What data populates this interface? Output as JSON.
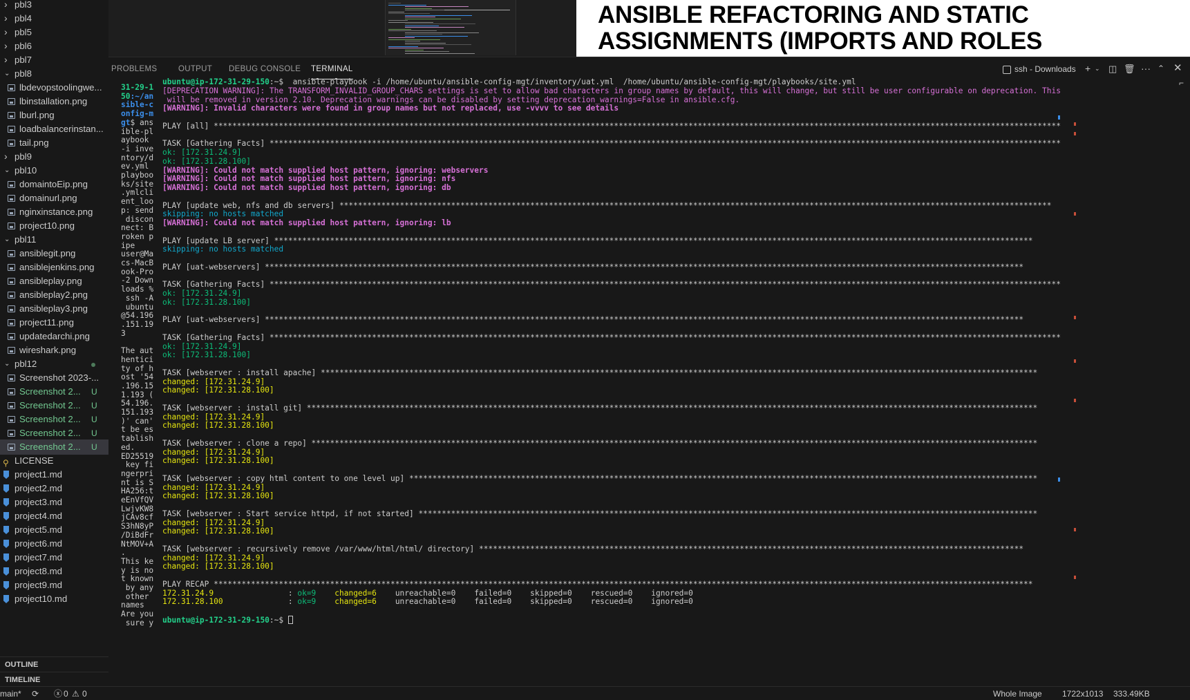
{
  "sidebar": {
    "items": [
      {
        "type": "folder",
        "label": "pbl3"
      },
      {
        "type": "folder",
        "label": "pbl4"
      },
      {
        "type": "folder",
        "label": "pbl5"
      },
      {
        "type": "folder",
        "label": "pbl6"
      },
      {
        "type": "folder",
        "label": "pbl7"
      },
      {
        "type": "folder-open",
        "label": "pbl8"
      },
      {
        "type": "file",
        "label": "lbdevopstoolingwe..."
      },
      {
        "type": "file",
        "label": "lbinstallation.png"
      },
      {
        "type": "file",
        "label": "lburl.png"
      },
      {
        "type": "file",
        "label": "loadbalancerinstan..."
      },
      {
        "type": "file",
        "label": "tail.png"
      },
      {
        "type": "folder",
        "label": "pbl9"
      },
      {
        "type": "folder-open",
        "label": "pbl10"
      },
      {
        "type": "file",
        "label": "domaintoEip.png"
      },
      {
        "type": "file",
        "label": "domainurl.png"
      },
      {
        "type": "file",
        "label": "nginxinstance.png"
      },
      {
        "type": "file",
        "label": "project10.png"
      },
      {
        "type": "folder-open",
        "label": "pbl11"
      },
      {
        "type": "file",
        "label": "ansiblegit.png"
      },
      {
        "type": "file",
        "label": "ansiblejenkins.png"
      },
      {
        "type": "file",
        "label": "ansibleplay.png"
      },
      {
        "type": "file",
        "label": "ansibleplay2.png"
      },
      {
        "type": "file",
        "label": "ansibleplay3.png"
      },
      {
        "type": "file",
        "label": "project11.png"
      },
      {
        "type": "file",
        "label": "updatedarchi.png"
      },
      {
        "type": "file",
        "label": "wireshark.png"
      },
      {
        "type": "folder-open",
        "label": "pbl12",
        "dot": true
      },
      {
        "type": "file",
        "label": "Screenshot 2023-..."
      },
      {
        "type": "file",
        "label": "Screenshot 2...",
        "badge": "U"
      },
      {
        "type": "file",
        "label": "Screenshot 2...",
        "badge": "U"
      },
      {
        "type": "file",
        "label": "Screenshot 2...",
        "badge": "U"
      },
      {
        "type": "file",
        "label": "Screenshot 2...",
        "badge": "U"
      },
      {
        "type": "file",
        "label": "Screenshot 2...",
        "badge": "U",
        "selected": true
      },
      {
        "type": "license",
        "label": "LICENSE"
      },
      {
        "type": "md",
        "label": "project1.md"
      },
      {
        "type": "md",
        "label": "project2.md"
      },
      {
        "type": "md",
        "label": "project3.md"
      },
      {
        "type": "md",
        "label": "project4.md"
      },
      {
        "type": "md",
        "label": "project5.md"
      },
      {
        "type": "md",
        "label": "project6.md"
      },
      {
        "type": "md",
        "label": "project7.md"
      },
      {
        "type": "md",
        "label": "project8.md"
      },
      {
        "type": "md",
        "label": "project9.md"
      },
      {
        "type": "md",
        "label": "project10.md"
      }
    ],
    "outline_label": "OUTLINE",
    "timeline_label": "TIMELINE"
  },
  "image_title": {
    "line1": "ANSIBLE REFACTORING AND STATIC",
    "line2": "ASSIGNMENTS (IMPORTS AND ROLES"
  },
  "panel": {
    "tabs": [
      "PROBLEMS",
      "OUTPUT",
      "DEBUG CONSOLE",
      "TERMINAL"
    ],
    "active_tab": "TERMINAL",
    "terminal_name": "ssh - Downloads"
  },
  "narrow_terminal": {
    "lines": [
      {
        "t": "31-29-1",
        "c": "g"
      },
      {
        "t": "50",
        "c": "g",
        "rest": ":~/an",
        "rc": "b"
      },
      {
        "t": "sible-c",
        "c": "b"
      },
      {
        "t": "onfig-m",
        "c": "b"
      },
      {
        "t": "gt",
        "c": "b",
        "rest": "$ ans"
      },
      {
        "t": "ible-pl"
      },
      {
        "t": "aybook "
      },
      {
        "t": "-i inve"
      },
      {
        "t": "ntory/d"
      },
      {
        "t": "ev.yml "
      },
      {
        "t": "playboo"
      },
      {
        "t": "ks/site"
      },
      {
        "t": ".ymlcli"
      },
      {
        "t": "ent_loo"
      },
      {
        "t": "p: send"
      },
      {
        "t": " discon"
      },
      {
        "t": "nect: B"
      },
      {
        "t": "roken p"
      },
      {
        "t": "ipe"
      },
      {
        "t": "user@Ma"
      },
      {
        "t": "cs-MacB"
      },
      {
        "t": "ook-Pro"
      },
      {
        "t": "-2 Down"
      },
      {
        "t": "loads %"
      },
      {
        "t": " ssh -A"
      },
      {
        "t": " ubuntu"
      },
      {
        "t": "@54.196"
      },
      {
        "t": ".151.19"
      },
      {
        "t": "3"
      },
      {
        "t": ""
      },
      {
        "t": "The aut"
      },
      {
        "t": "hentici"
      },
      {
        "t": "ty of h"
      },
      {
        "t": "ost '54"
      },
      {
        "t": ".196.15"
      },
      {
        "t": "1.193 ("
      },
      {
        "t": "54.196."
      },
      {
        "t": "151.193"
      },
      {
        "t": ")' can'"
      },
      {
        "t": "t be es"
      },
      {
        "t": "tablish"
      },
      {
        "t": "ed."
      },
      {
        "t": "ED25519"
      },
      {
        "t": " key fi"
      },
      {
        "t": "ngerpri"
      },
      {
        "t": "nt is S"
      },
      {
        "t": "HA256:t"
      },
      {
        "t": "eEnVfQV"
      },
      {
        "t": "LwjvKW8"
      },
      {
        "t": "jCAv8cf"
      },
      {
        "t": "S3hN8yP"
      },
      {
        "t": "/DiBdFr"
      },
      {
        "t": "NtMOV+A"
      },
      {
        "t": "."
      },
      {
        "t": "This ke"
      },
      {
        "t": "y is no"
      },
      {
        "t": "t known"
      },
      {
        "t": " by any"
      },
      {
        "t": " other "
      },
      {
        "t": "names"
      },
      {
        "t": "Are you"
      },
      {
        "t": " sure y"
      }
    ]
  },
  "terminal": {
    "lines": [
      [
        {
          "t": "ubuntu@ip-172-31-29-150",
          "c": "prompt"
        },
        {
          "t": ":~$ ",
          "c": ""
        },
        {
          "t": " ansible-playbook -i /home/ubuntu/ansible-config-mgt/inventory/uat.yml  /home/ubuntu/ansible-config-mgt/playbooks/site.yml",
          "c": ""
        }
      ],
      [
        {
          "t": "[DEPRECATION WARNING]: The TRANSFORM_INVALID_GROUP_CHARS settings is set to allow bad characters in group names by default, this will change, but still be user configurable on deprecation. This feature",
          "c": "dep"
        }
      ],
      [
        {
          "t": " will be removed in version 2.10. Deprecation warnings can be disabled by setting deprecation_warnings=False in ansible.cfg.",
          "c": "dep"
        }
      ],
      [
        {
          "t": "[WARNING]: Invalid characters were found in group names but not replaced, use -vvvv to see details",
          "c": "warn"
        }
      ],
      [],
      [
        {
          "t": "PLAY [all] ****************************************************************************************************************************************************************************************",
          "c": ""
        }
      ],
      [],
      [
        {
          "t": "TASK [Gathering Facts] ****************************************************************************************************************************************************************************",
          "c": ""
        }
      ],
      [
        {
          "t": "ok: [172.31.24.9]",
          "c": "ok"
        }
      ],
      [
        {
          "t": "ok: [172.31.28.100]",
          "c": "ok"
        }
      ],
      [
        {
          "t": "[WARNING]: Could not match supplied host pattern, ignoring: webservers",
          "c": "warn"
        }
      ],
      [
        {
          "t": "[WARNING]: Could not match supplied host pattern, ignoring: nfs",
          "c": "warn"
        }
      ],
      [
        {
          "t": "[WARNING]: Could not match supplied host pattern, ignoring: db",
          "c": "warn"
        }
      ],
      [],
      [
        {
          "t": "PLAY [update web, nfs and db servers] *********************************************************************************************************************************************************",
          "c": ""
        }
      ],
      [
        {
          "t": "skipping: no hosts matched",
          "c": "skip"
        }
      ],
      [
        {
          "t": "[WARNING]: Could not match supplied host pattern, ignoring: lb",
          "c": "warn"
        }
      ],
      [],
      [
        {
          "t": "PLAY [update LB server] *******************************************************************************************************************************************************************",
          "c": ""
        }
      ],
      [
        {
          "t": "skipping: no hosts matched",
          "c": "skip"
        }
      ],
      [],
      [
        {
          "t": "PLAY [uat-webservers] *******************************************************************************************************************************************************************",
          "c": ""
        }
      ],
      [],
      [
        {
          "t": "TASK [Gathering Facts] ****************************************************************************************************************************************************************************",
          "c": ""
        }
      ],
      [
        {
          "t": "ok: [172.31.24.9]",
          "c": "ok"
        }
      ],
      [
        {
          "t": "ok: [172.31.28.100]",
          "c": "ok"
        }
      ],
      [],
      [
        {
          "t": "PLAY [uat-webservers] *******************************************************************************************************************************************************************",
          "c": ""
        }
      ],
      [],
      [
        {
          "t": "TASK [Gathering Facts] ****************************************************************************************************************************************************************************",
          "c": ""
        }
      ],
      [
        {
          "t": "ok: [172.31.24.9]",
          "c": "ok"
        }
      ],
      [
        {
          "t": "ok: [172.31.28.100]",
          "c": "ok"
        }
      ],
      [],
      [
        {
          "t": "TASK [webserver : install apache] **********************************************************************************************************************************************************",
          "c": ""
        }
      ],
      [
        {
          "t": "changed: [172.31.24.9]",
          "c": "changed"
        }
      ],
      [
        {
          "t": "changed: [172.31.28.100]",
          "c": "changed"
        }
      ],
      [],
      [
        {
          "t": "TASK [webserver : install git] *************************************************************************************************************************************************************",
          "c": ""
        }
      ],
      [
        {
          "t": "changed: [172.31.24.9]",
          "c": "changed"
        }
      ],
      [
        {
          "t": "changed: [172.31.28.100]",
          "c": "changed"
        }
      ],
      [],
      [
        {
          "t": "TASK [webserver : clone a repo] ************************************************************************************************************************************************************",
          "c": ""
        }
      ],
      [
        {
          "t": "changed: [172.31.24.9]",
          "c": "changed"
        }
      ],
      [
        {
          "t": "changed: [172.31.28.100]",
          "c": "changed"
        }
      ],
      [],
      [
        {
          "t": "TASK [webserver : copy html content to one level up] ***************************************************************************************************************************************",
          "c": ""
        }
      ],
      [
        {
          "t": "changed: [172.31.24.9]",
          "c": "changed"
        }
      ],
      [
        {
          "t": "changed: [172.31.28.100]",
          "c": "changed"
        }
      ],
      [],
      [
        {
          "t": "TASK [webserver : Start service httpd, if not started] *************************************************************************************************************************************",
          "c": ""
        }
      ],
      [
        {
          "t": "changed: [172.31.24.9]",
          "c": "changed"
        }
      ],
      [
        {
          "t": "changed: [172.31.28.100]",
          "c": "changed"
        }
      ],
      [],
      [
        {
          "t": "TASK [webserver : recursively remove /var/www/html/html/ directory] *********************************************************************************************************************",
          "c": ""
        }
      ],
      [
        {
          "t": "changed: [172.31.24.9]",
          "c": "changed"
        }
      ],
      [
        {
          "t": "changed: [172.31.28.100]",
          "c": "changed"
        }
      ],
      [],
      [
        {
          "t": "PLAY RECAP ********************************************************************************************************************************************************************************",
          "c": ""
        }
      ],
      [
        {
          "t": "172.31.24.9",
          "c": "host"
        },
        {
          "t": "                : ",
          "c": ""
        },
        {
          "t": "ok=9",
          "c": "ok"
        },
        {
          "t": "    ",
          "c": ""
        },
        {
          "t": "changed=6",
          "c": "changed"
        },
        {
          "t": "    unreachable=0    failed=0    skipped=0    rescued=0    ignored=0",
          "c": ""
        }
      ],
      [
        {
          "t": "172.31.28.100",
          "c": "host"
        },
        {
          "t": "              : ",
          "c": ""
        },
        {
          "t": "ok=9",
          "c": "ok"
        },
        {
          "t": "    ",
          "c": ""
        },
        {
          "t": "changed=6",
          "c": "changed"
        },
        {
          "t": "    unreachable=0    failed=0    skipped=0    rescued=0    ignored=0",
          "c": ""
        }
      ],
      [],
      [
        {
          "t": "ubuntu@ip-172-31-29-150",
          "c": "prompt"
        },
        {
          "t": ":~$ ",
          "c": ""
        },
        {
          "cursor": true
        }
      ]
    ]
  },
  "statusbar": {
    "branch": "main*",
    "errors": "0",
    "warnings": "0",
    "image_mode": "Whole Image",
    "image_size": "1722x1013",
    "file_size": "333.49KB"
  },
  "colors": {
    "background": "#1e1e1e",
    "sidebar": "#181818",
    "prompt_green": "#23d18b",
    "warning_magenta": "#d670d6",
    "changed_yellow": "#e5e510",
    "ok_green": "#0dbc79",
    "skip_cyan": "#11a8cd"
  }
}
